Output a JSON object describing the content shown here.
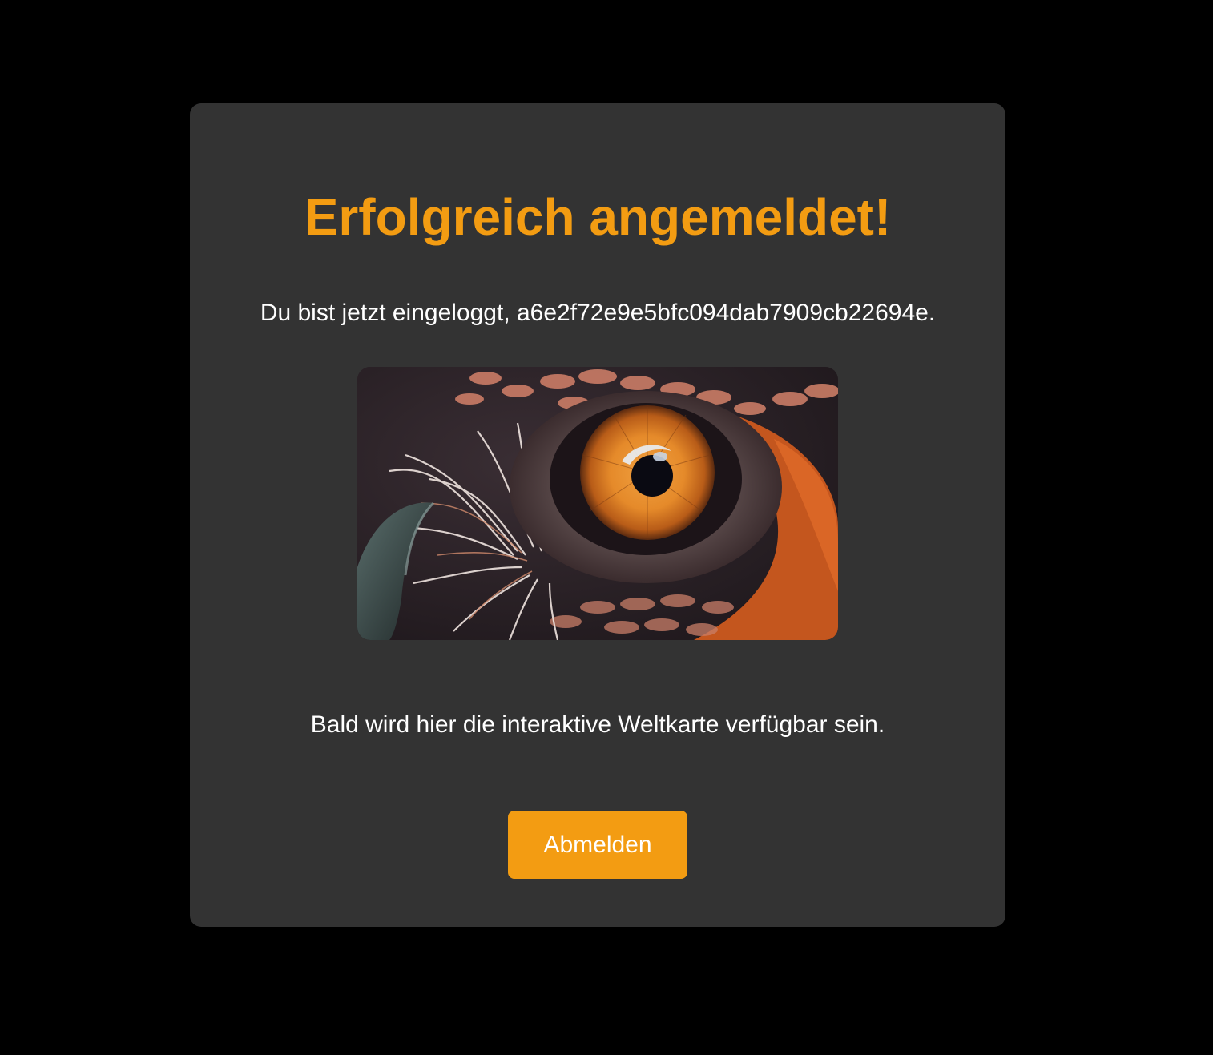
{
  "card": {
    "title": "Erfolgreich angemeldet!",
    "welcome_text": "Du bist jetzt eingeloggt, a6e2f72e9e5bfc094dab7909cb22694e.",
    "image": {
      "subject": "bird-eye-icon"
    },
    "info_text": "Bald wird hier die interaktive Weltkarte verfügbar sein.",
    "logout_label": "Abmelden"
  },
  "colors": {
    "page_background": "#000000",
    "card_background": "#333333",
    "accent": "#f39c12",
    "text": "#ffffff"
  }
}
